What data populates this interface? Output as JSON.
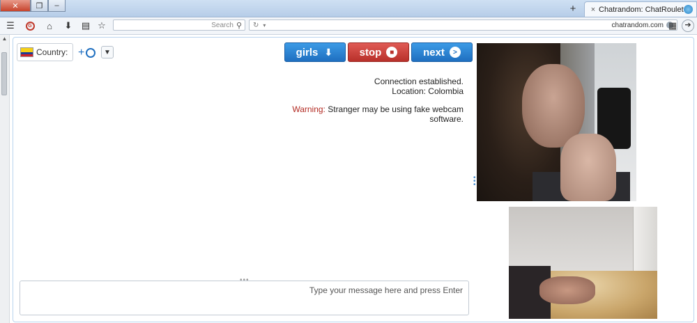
{
  "browser": {
    "tab_title": "Chatrandom: ChatRoulette...",
    "tab_close": "×",
    "new_tab": "+",
    "url": "chatrandom.com",
    "search_placeholder": "Search"
  },
  "controls": {
    "next_label": "next",
    "stop_label": "stop",
    "girls_label": "girls",
    "country_label": "Country:",
    "flag_colors": [
      "#f7d116",
      "#1f3c96",
      "#d02128"
    ]
  },
  "chat": {
    "status_line1": "Connection established.",
    "status_line2": "Location: Colombia",
    "warning_label": "Warning:",
    "warning_text": " Stranger may be using fake webcam software.",
    "input_placeholder": "Type your message here and press Enter"
  },
  "colors": {
    "accent_blue": "#1f6fc0",
    "stop_red": "#b8302a",
    "warning_red": "#b22a22"
  }
}
